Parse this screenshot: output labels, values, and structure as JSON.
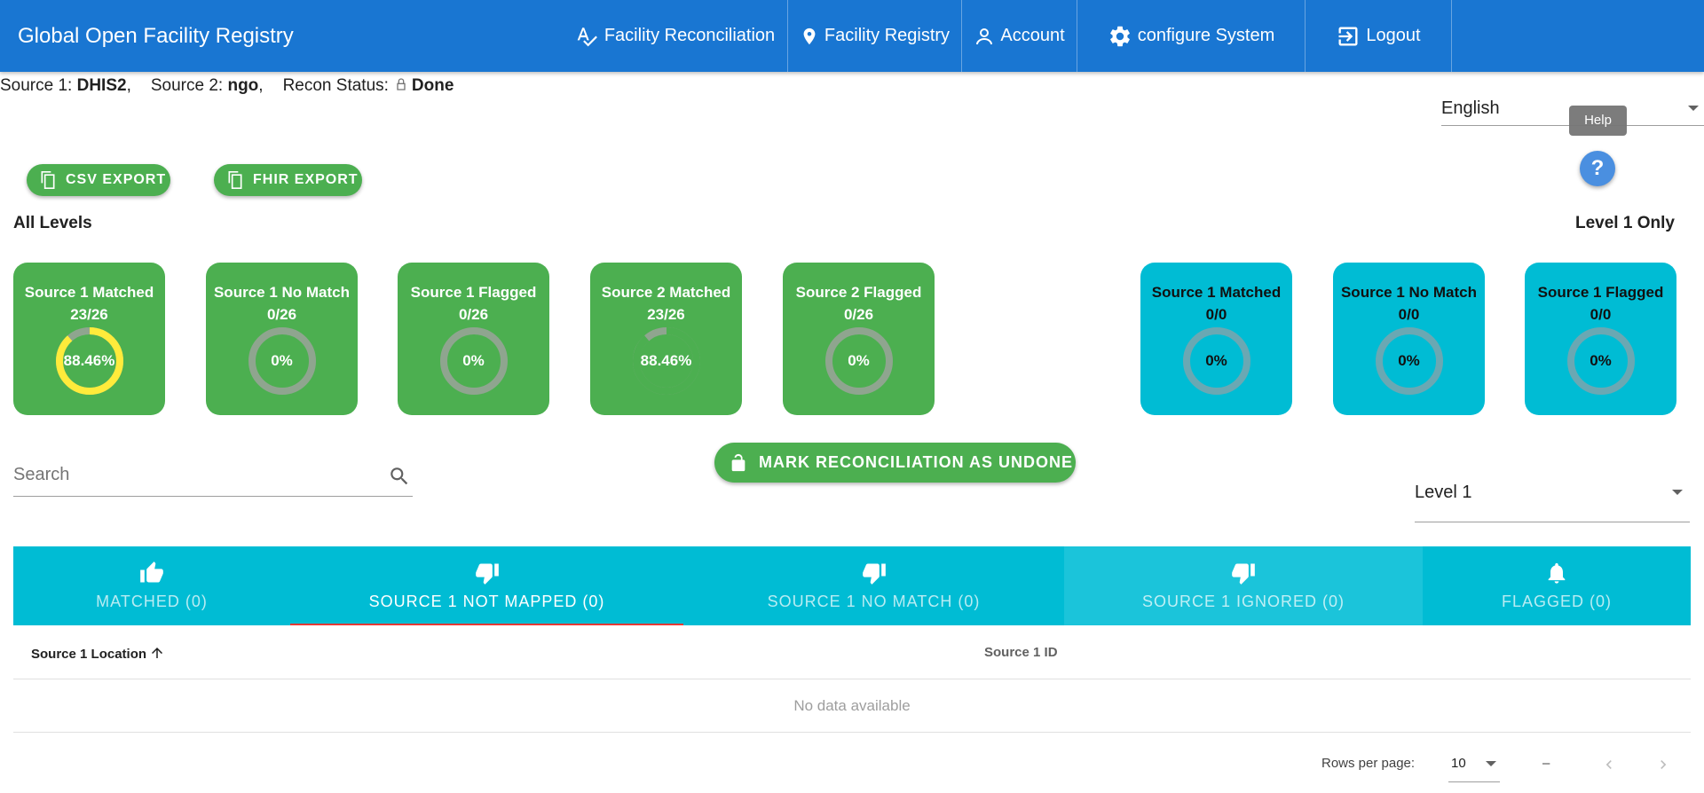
{
  "app": {
    "title": "Global Open Facility Registry"
  },
  "nav": {
    "reconciliation": "Facility Reconciliation",
    "registry": "Facility Registry",
    "account": "Account",
    "configure": "configure System",
    "logout": "Logout"
  },
  "source_line": {
    "source1_label": "Source 1:",
    "source1_value": "DHIS2",
    "source2_label": "Source 2:",
    "source2_value": "ngo",
    "status_label": "Recon Status:",
    "status_value": "Done"
  },
  "language": {
    "selected": "English"
  },
  "help": {
    "tooltip": "Help",
    "button": "?"
  },
  "exports": {
    "csv": "CSV EXPORT",
    "fhir": "FHIR EXPORT"
  },
  "sections": {
    "all_levels": "All Levels",
    "level1_only": "Level 1 Only"
  },
  "all_level_cards": [
    {
      "title": "Source 1 Matched",
      "count": "23/26",
      "percent_label": "88.46%",
      "fraction": 0.8846,
      "ring_color": "#ffeb3b"
    },
    {
      "title": "Source 1 No Match",
      "count": "0/26",
      "percent_label": "0%",
      "fraction": 0,
      "ring_color": "#ffeb3b"
    },
    {
      "title": "Source 1 Flagged",
      "count": "0/26",
      "percent_label": "0%",
      "fraction": 0,
      "ring_color": "#ffeb3b"
    },
    {
      "title": "Source 2 Matched",
      "count": "23/26",
      "percent_label": "88.46%",
      "fraction": 0.8846,
      "ring_color": "#4caf50"
    },
    {
      "title": "Source 2 Flagged",
      "count": "0/26",
      "percent_label": "0%",
      "fraction": 0,
      "ring_color": "#ffeb3b"
    }
  ],
  "level1_cards": [
    {
      "title": "Source 1 Matched",
      "count": "0/0",
      "percent_label": "0%",
      "fraction": 0
    },
    {
      "title": "Source 1 No Match",
      "count": "0/0",
      "percent_label": "0%",
      "fraction": 0
    },
    {
      "title": "Source 1 Flagged",
      "count": "0/0",
      "percent_label": "0%",
      "fraction": 0
    }
  ],
  "search": {
    "placeholder": "Search"
  },
  "mark_button": "MARK RECONCILIATION AS UNDONE",
  "level_select": {
    "selected": "Level 1"
  },
  "tabs": [
    {
      "label": "MATCHED (0)",
      "icon": "thumb-up-icon"
    },
    {
      "label": "SOURCE 1 NOT MAPPED (0)",
      "icon": "thumb-down-icon",
      "active": true
    },
    {
      "label": "SOURCE 1 NO MATCH (0)",
      "icon": "thumb-down-icon"
    },
    {
      "label": "SOURCE 1 IGNORED (0)",
      "icon": "thumb-down-icon"
    },
    {
      "label": "FLAGGED (0)",
      "icon": "bell-icon"
    }
  ],
  "table": {
    "columns": [
      "Source 1 Location",
      "Source 1 ID"
    ],
    "empty_text": "No data available"
  },
  "pagination": {
    "rows_per_page_label": "Rows per page:",
    "rows_per_page": "10",
    "range": "–"
  },
  "colors": {
    "appbar": "#1976d2",
    "green": "#4caf50",
    "cyan": "#00bcd4",
    "ring_track": "#8a9a8a",
    "ring_fill": "#ffeb3b"
  }
}
